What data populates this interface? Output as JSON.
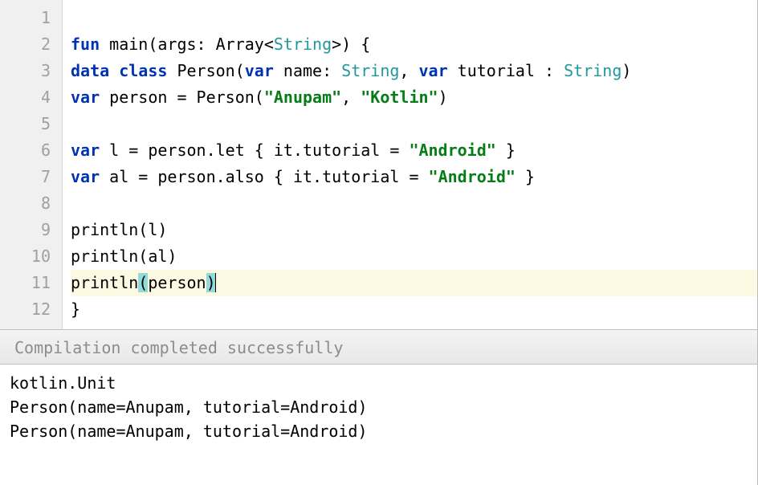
{
  "editor": {
    "lines": [
      {
        "num": "1",
        "tokens": []
      },
      {
        "num": "2",
        "tokens": [
          {
            "t": "kw",
            "v": "fun"
          },
          {
            "t": "plain",
            "v": " main(args: Array<"
          },
          {
            "t": "type",
            "v": "String"
          },
          {
            "t": "plain",
            "v": ">) {"
          }
        ]
      },
      {
        "num": "3",
        "tokens": [
          {
            "t": "kw",
            "v": "data class"
          },
          {
            "t": "plain",
            "v": " Person("
          },
          {
            "t": "kw",
            "v": "var"
          },
          {
            "t": "plain",
            "v": " name: "
          },
          {
            "t": "type",
            "v": "String"
          },
          {
            "t": "plain",
            "v": ", "
          },
          {
            "t": "kw",
            "v": "var"
          },
          {
            "t": "plain",
            "v": " tutorial : "
          },
          {
            "t": "type",
            "v": "String"
          },
          {
            "t": "plain",
            "v": ")"
          }
        ]
      },
      {
        "num": "4",
        "tokens": [
          {
            "t": "kw",
            "v": "var"
          },
          {
            "t": "plain",
            "v": " person = Person("
          },
          {
            "t": "str",
            "v": "\"Anupam\""
          },
          {
            "t": "plain",
            "v": ", "
          },
          {
            "t": "str",
            "v": "\"Kotlin\""
          },
          {
            "t": "plain",
            "v": ")"
          }
        ]
      },
      {
        "num": "5",
        "tokens": []
      },
      {
        "num": "6",
        "tokens": [
          {
            "t": "kw",
            "v": "var"
          },
          {
            "t": "plain",
            "v": " l = person.let { it.tutorial = "
          },
          {
            "t": "str",
            "v": "\"Android\""
          },
          {
            "t": "plain",
            "v": " }"
          }
        ]
      },
      {
        "num": "7",
        "tokens": [
          {
            "t": "kw",
            "v": "var"
          },
          {
            "t": "plain",
            "v": " al = person.also { it.tutorial = "
          },
          {
            "t": "str",
            "v": "\"Android\""
          },
          {
            "t": "plain",
            "v": " }"
          }
        ]
      },
      {
        "num": "8",
        "tokens": []
      },
      {
        "num": "9",
        "tokens": [
          {
            "t": "plain",
            "v": "println(l)"
          }
        ]
      },
      {
        "num": "10",
        "tokens": [
          {
            "t": "plain",
            "v": "println(al)"
          }
        ]
      },
      {
        "num": "11",
        "highlighted": true,
        "tokens": [
          {
            "t": "plain",
            "v": "println"
          },
          {
            "t": "plain",
            "v": "(",
            "hl": true
          },
          {
            "t": "plain",
            "v": "person"
          },
          {
            "t": "plain",
            "v": ")",
            "hl": true
          }
        ],
        "caret": true
      },
      {
        "num": "12",
        "tokens": [
          {
            "t": "plain",
            "v": "}"
          }
        ]
      }
    ]
  },
  "status": {
    "message": "Compilation completed successfully"
  },
  "output": {
    "lines": [
      "kotlin.Unit",
      "Person(name=Anupam, tutorial=Android)",
      "Person(name=Anupam, tutorial=Android)"
    ]
  }
}
